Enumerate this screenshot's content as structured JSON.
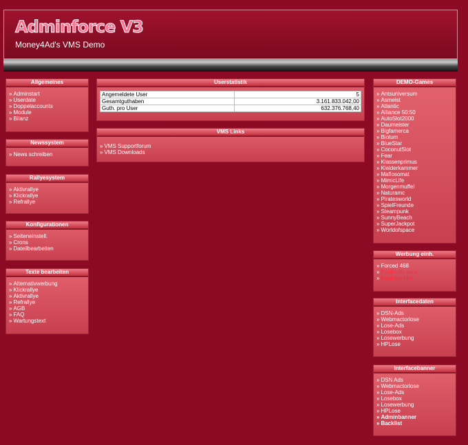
{
  "header": {
    "logo": "Adminforce V3",
    "subtitle": "Money4Ad's VMS Demo"
  },
  "left": {
    "allgemeines": {
      "title": "Allgemeines",
      "items": [
        "Adminstart",
        "Userdate",
        "Doppelaccounts",
        "Module",
        "Bilanz"
      ]
    },
    "newssystem": {
      "title": "Newssystem",
      "items": [
        "News schreiben"
      ]
    },
    "rallyesystem": {
      "title": "Rallyesystem",
      "items": [
        "Aktivrallye",
        "Klickrallye",
        "Refrallye"
      ]
    },
    "konfigurationen": {
      "title": "Konfigurationen",
      "items": [
        "Seiteneinstell.",
        "Crons",
        "Dateilbearbeiten"
      ]
    },
    "texte": {
      "title": "Texte bearbeiten",
      "items": [
        "Alternativwerbung",
        "Klickrallye",
        "Aktivrallye",
        "Refrallye",
        "AGB",
        "FAQ",
        "Wartungstext"
      ]
    }
  },
  "center": {
    "userstatistik": {
      "title": "Userstatistik",
      "rows": [
        {
          "label": "Angemeldete User",
          "value": "5"
        },
        {
          "label": "Gesamtguthaben",
          "value": "3.161.833.042,00"
        },
        {
          "label": "Guth. pro User",
          "value": "632.376.768,40"
        }
      ]
    },
    "vmslinks": {
      "title": "VMS Links",
      "items": [
        "VMS Supportforum",
        "VMS Downloads"
      ]
    }
  },
  "right": {
    "demogames": {
      "title": "DEMO-Games",
      "items": [
        "Antsuniversum",
        "Asmeist",
        "Atlantic",
        "Alliance 50:50",
        "AutoSlot2000",
        "Daumeister",
        "Bigfamerca",
        "Biotum",
        "BlueStar",
        "CoconutSlot",
        "Fear",
        "Klassenprimus",
        "Kleiderkammer",
        "Mafiosomat",
        "MimicLife",
        "Morgenmuffel",
        "Naturamc",
        "Piratesworld",
        "SpielFreunde",
        "Steampunk",
        "SunnyBeach",
        "SuperJackpot",
        "Worldofspace"
      ]
    },
    "werbung": {
      "title": "Werbung einh.",
      "items": [
        {
          "label": "Forced 468",
          "red": false
        },
        {
          "label": "Paidmails vers.",
          "red": true
        },
        {
          "label": "Paidmail-Hot",
          "red": true
        }
      ]
    },
    "interfacedaten": {
      "title": "Interfacedaten",
      "items": [
        "DSN-Ads",
        "Webmactorlose",
        "Lose-Ads",
        "Losebox",
        "Losewerbung",
        "HPLose"
      ]
    },
    "interfacebanner": {
      "title": "Interfacebanner",
      "items": [
        {
          "label": "DSN Ads",
          "bold": false
        },
        {
          "label": "Webmactorlose",
          "bold": false
        },
        {
          "label": "Lose-Ads",
          "bold": false
        },
        {
          "label": "Losebox",
          "bold": false
        },
        {
          "label": "Losewerbung",
          "bold": false
        },
        {
          "label": "HPLose",
          "bold": false
        },
        {
          "label": "Adminbanner",
          "bold": true
        },
        {
          "label": "Backlist",
          "bold": true
        }
      ]
    }
  }
}
